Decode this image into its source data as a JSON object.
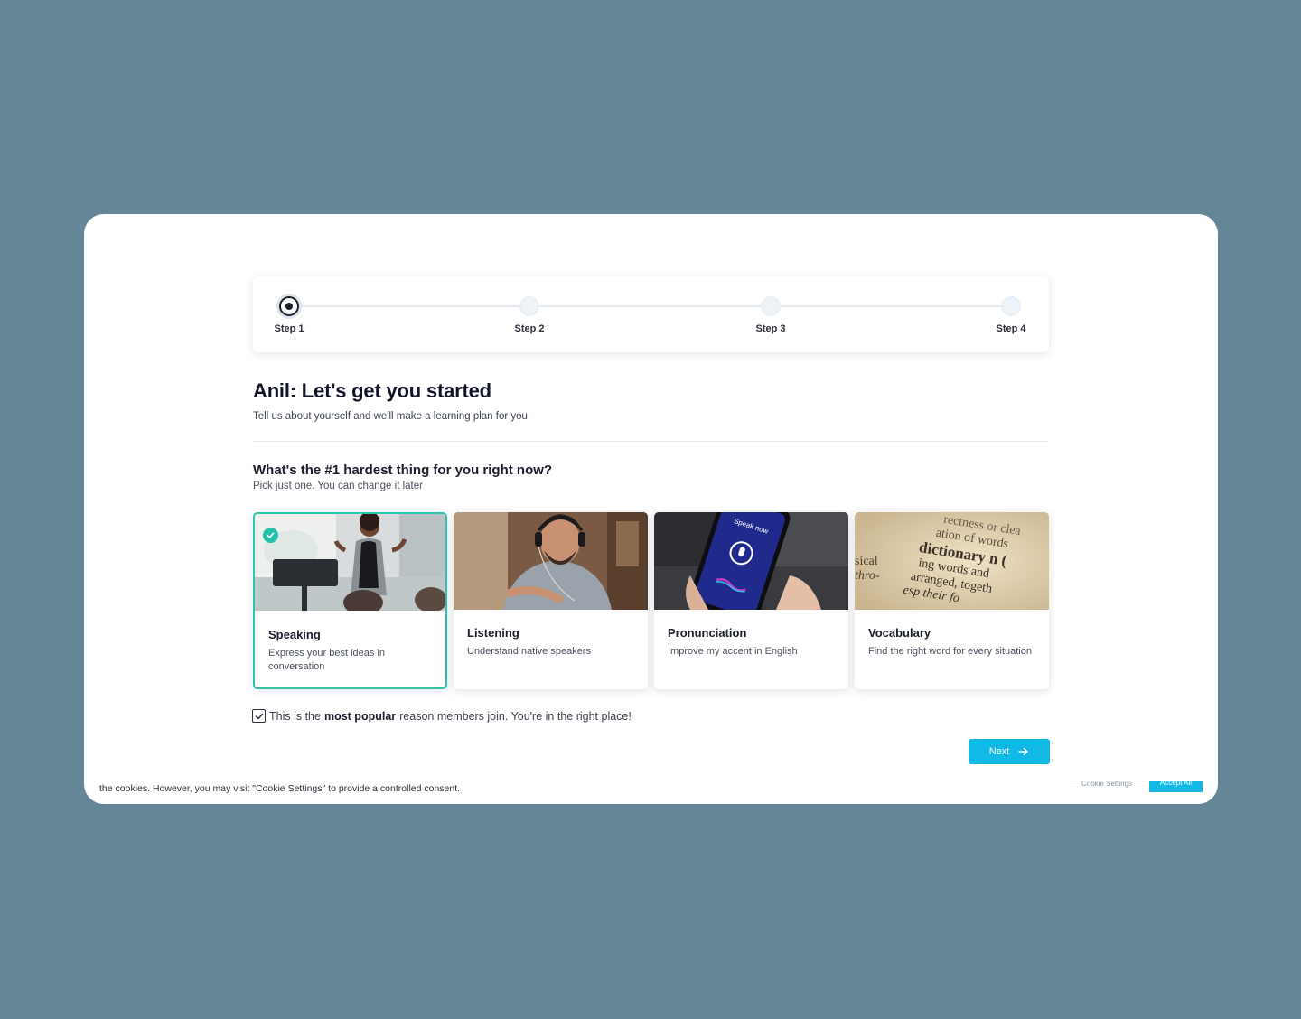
{
  "stepper": {
    "steps": [
      {
        "label": "Step 1",
        "state": "active"
      },
      {
        "label": "Step 2",
        "state": "upcoming"
      },
      {
        "label": "Step 3",
        "state": "upcoming"
      },
      {
        "label": "Step 4",
        "state": "upcoming"
      }
    ]
  },
  "header": {
    "title": "Anil: Let's get you started",
    "subtitle": "Tell us about yourself and we'll make a learning plan for you"
  },
  "question": {
    "title": "What's the #1 hardest thing for you right now?",
    "hint": "Pick just one. You can change it later"
  },
  "options": [
    {
      "title": "Speaking",
      "description": "Express your best ideas in conversation",
      "selected": true,
      "image_icon": "speaker-presenting-photo"
    },
    {
      "title": "Listening",
      "description": "Understand native speakers",
      "selected": false,
      "image_icon": "man-with-headphones-photo"
    },
    {
      "title": "Pronunciation",
      "description": "Improve my accent in English",
      "selected": false,
      "image_icon": "phone-speak-now-photo"
    },
    {
      "title": "Vocabulary",
      "description": "Find the right word for every situation",
      "selected": false,
      "image_icon": "dictionary-page-photo"
    }
  ],
  "phone_screen_text": "Speak now",
  "dictionary_text": [
    "rectness or clea",
    "ation of words",
    "dictionary n (",
    "ing words and",
    "arranged, togeth",
    "esp their fo",
    "sical",
    "thro-"
  ],
  "note": {
    "prefix": "This is the",
    "bold": "most popular",
    "suffix": "reason members join. You're in the right place!",
    "checked": true
  },
  "next_button": {
    "label": "Next"
  },
  "cookie_banner": {
    "text": "the cookies. However, you may visit \"Cookie Settings\" to provide a controlled consent.",
    "settings_label": "Cookie Settings",
    "accept_label": "Accept All"
  },
  "colors": {
    "background": "#648696",
    "accent": "#12b9e6",
    "selected_border": "#2ec4b0",
    "heading": "#111428"
  }
}
